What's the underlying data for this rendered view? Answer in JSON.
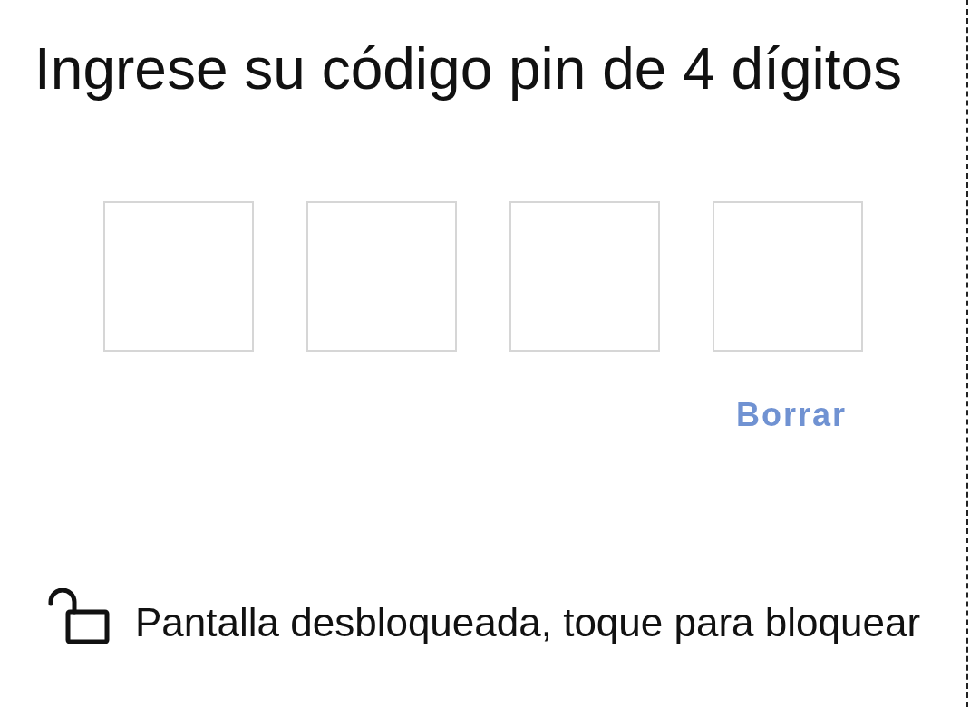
{
  "title": "Ingrese su código pin de 4 dígitos",
  "pin_fields": [
    {
      "filled": false
    },
    {
      "filled": false
    },
    {
      "filled": false
    },
    {
      "filled": false
    }
  ],
  "clear_button": "Borrar",
  "lock_status": {
    "locked": false,
    "text": "Pantalla desbloqueada, toque para bloquear"
  }
}
